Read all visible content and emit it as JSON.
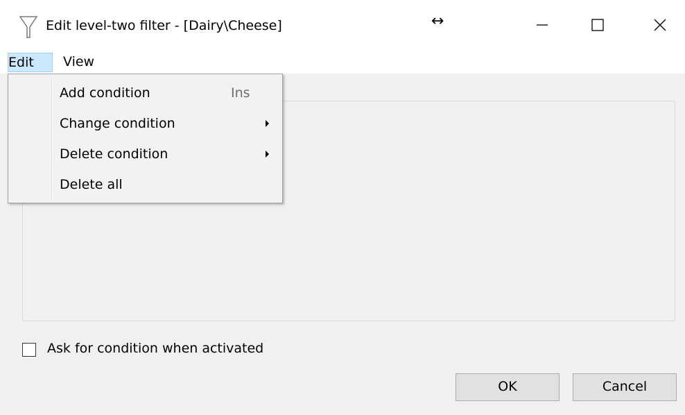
{
  "window": {
    "title": "Edit level-two filter - [Dairy\\Cheese]",
    "resize_glyph": "↔",
    "title_icon": "funnel-icon",
    "controls": {
      "minimize_icon": "minimize-icon",
      "maximize_icon": "maximize-icon",
      "close_icon": "close-icon"
    }
  },
  "menubar": {
    "items": [
      {
        "label": "Edit",
        "active": true
      },
      {
        "label": "View",
        "active": false
      }
    ]
  },
  "edit_menu": {
    "items": [
      {
        "label": "Add condition",
        "shortcut": "Ins",
        "submenu": false
      },
      {
        "label": "Change condition",
        "shortcut": "",
        "submenu": true
      },
      {
        "label": "Delete condition",
        "shortcut": "",
        "submenu": true
      },
      {
        "label": "Delete all",
        "shortcut": "",
        "submenu": false
      }
    ]
  },
  "options": {
    "ask_condition_label": "Ask for condition when activated",
    "ask_condition_checked": false
  },
  "buttons": {
    "ok_label": "OK",
    "cancel_label": "Cancel"
  },
  "colors": {
    "menu_highlight": "#cce8ff",
    "menu_highlight_border": "#99d1ff",
    "window_bg": "#f0f0f0",
    "button_bg": "#e1e1e1"
  }
}
